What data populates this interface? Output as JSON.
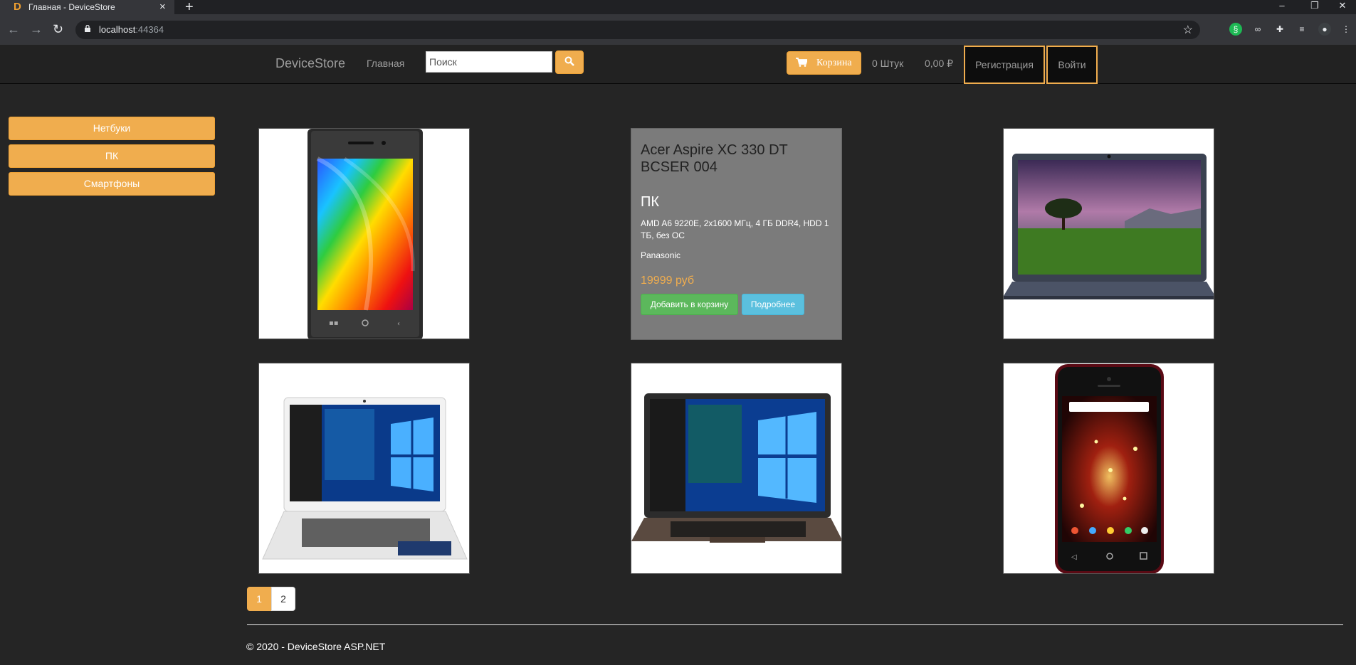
{
  "browser": {
    "tab_title": "Главная - DeviceStore",
    "tab_favicon_letter": "D",
    "url_host": "localhost",
    "url_port": ":44364"
  },
  "header": {
    "brand": "DeviceStore",
    "nav_home": "Главная",
    "search_placeholder": "Поиск",
    "cart_label": "Корзина",
    "cart_count": "0 Штук",
    "cart_total": "0,00 ₽",
    "register_label": "Регистрация",
    "login_label": "Войти"
  },
  "sidebar": {
    "categories": [
      "Нетбуки",
      "ПК",
      "Смартфоны"
    ]
  },
  "products": [
    {
      "image": "smartphone-rainbow-image"
    },
    {
      "name": "Acer Aspire XC 330 DT BCSER 004",
      "category": "ПК",
      "description": "AMD A6 9220E, 2x1600 МГц, 4 ГБ DDR4, HDD 1 ТБ, без ОС",
      "brand": "Panasonic",
      "price": "19999 руб",
      "add_to_cart_label": "Добавить в корзину",
      "details_label": "Подробнее"
    },
    {
      "image": "laptop-landscape-image"
    },
    {
      "image": "white-laptop-windows-image"
    },
    {
      "image": "dark-laptop-windows-image"
    },
    {
      "image": "red-smartphone-image"
    }
  ],
  "pagination": {
    "pages": [
      "1",
      "2"
    ],
    "active": "1"
  },
  "footer": {
    "text": "© 2020 - DeviceStore ASP.NET"
  },
  "colors": {
    "accent": "#f0ad4e",
    "background": "#252525",
    "success": "#5cb85c",
    "info": "#5bc0de"
  }
}
